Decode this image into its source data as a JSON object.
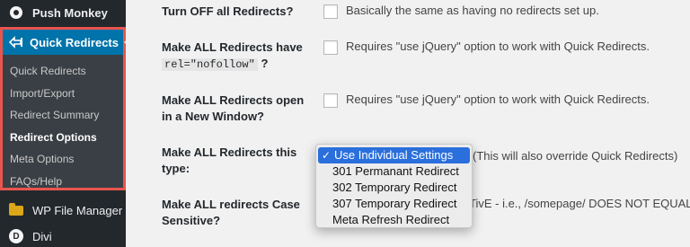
{
  "sidebar": {
    "push_monkey": "Push Monkey",
    "quick_redirects": "Quick Redirects",
    "submenu": [
      {
        "label": "Quick Redirects",
        "current": false
      },
      {
        "label": "Import/Export",
        "current": false
      },
      {
        "label": "Redirect Summary",
        "current": false
      },
      {
        "label": "Redirect Options",
        "current": true
      },
      {
        "label": "Meta Options",
        "current": false
      },
      {
        "label": "FAQs/Help",
        "current": false
      }
    ],
    "wp_file_manager": "WP File Manager",
    "divi": "Divi",
    "icons": [
      "push-monkey-icon",
      "redirect-arrow-icon",
      "folder-icon",
      "divi-icon"
    ]
  },
  "options": {
    "turn_off": {
      "label": "Turn OFF all Redirects?",
      "desc": "Basically the same as having no redirects set up."
    },
    "nofollow": {
      "label": "Make ALL Redirects have",
      "code": "rel=\"nofollow\"",
      "suffix": "?",
      "desc": "Requires \"use jQuery\" option to work with Quick Redirects."
    },
    "new_window": {
      "label_line1": "Make ALL Redirects open",
      "label_line2": "in a New Window?",
      "desc": "Requires \"use jQuery\" option to work with Quick Redirects."
    },
    "type": {
      "label_line1": "Make ALL Redirects this",
      "label_line2": "type:",
      "hint": "(This will also override Quick Redirects)",
      "selected": "Use Individual Settings",
      "options": [
        "Use Individual Settings",
        "301 Permanant Redirect",
        "302 Temporary Redirect",
        "307 Temporary Redirect",
        "Meta Refresh Redirect"
      ]
    },
    "case": {
      "label_line1": "Make ALL redirects Case",
      "label_line2": "Sensitive?",
      "desc_partial": "TivE - i.e., /somepage/ DOES NOT EQUAL"
    }
  },
  "colors": {
    "sidebar_bg": "#23282d",
    "active_blue": "#0073aa",
    "highlight_border": "#e8554e",
    "selection_blue": "#2a6fdc"
  }
}
